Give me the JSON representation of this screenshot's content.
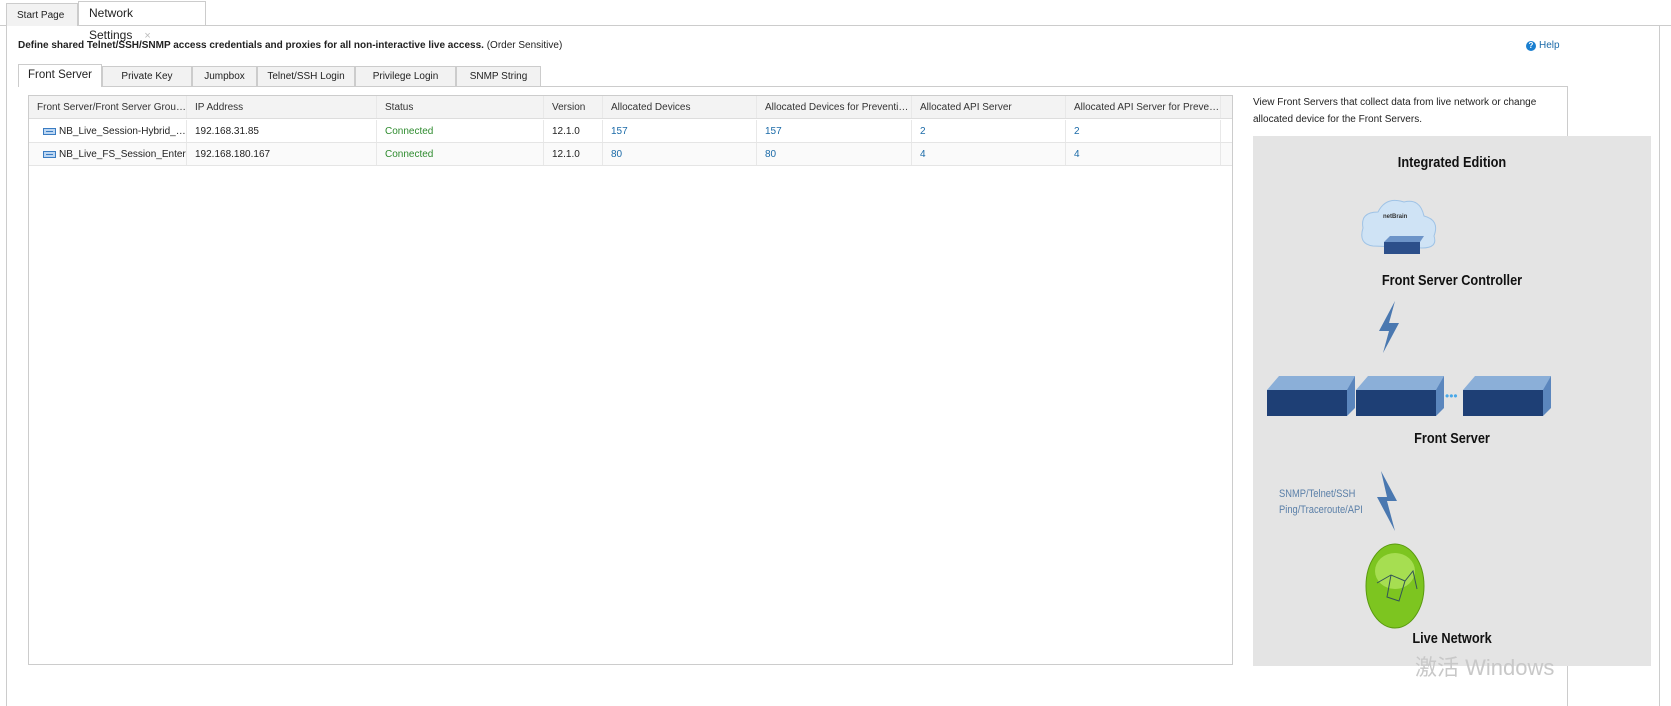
{
  "top_tabs": [
    {
      "label": "Start Page"
    },
    {
      "label": "Network Settings",
      "close": "×"
    }
  ],
  "description": {
    "bold": "Define shared Telnet/SSH/SNMP access credentials and proxies for all non-interactive live access.",
    "note": "(Order Sensitive)"
  },
  "help": {
    "icon": "?",
    "label": "Help"
  },
  "inner_tabs": [
    "Front Server",
    "Private Key",
    "Jumpbox",
    "Telnet/SSH Login",
    "Privilege Login",
    "SNMP String"
  ],
  "table": {
    "columns": [
      "Front Server/Front Server Group ...",
      "IP Address",
      "Status",
      "Version",
      "Allocated Devices",
      "Allocated Devices for Preventive ...",
      "Allocated API Server",
      "Allocated API Server for Preventiv..."
    ],
    "rows": [
      {
        "name": "NB_Live_Session-Hybrid_FS",
        "ip": "192.168.31.85",
        "status": "Connected",
        "version": "12.1.0",
        "alloc": "157",
        "alloc_prev": "157",
        "api": "2",
        "api_prev": "2"
      },
      {
        "name": "NB_Live_FS_Session_Enterprise",
        "ip": "192.168.180.167",
        "status": "Connected",
        "version": "12.1.0",
        "alloc": "80",
        "alloc_prev": "80",
        "api": "4",
        "api_prev": "4"
      }
    ]
  },
  "side": {
    "text": "View Front Servers that collect data from live network or change allocated device for the Front Servers.",
    "diagram": {
      "edition": "Integrated Edition",
      "controller": "Front Server Controller",
      "front_server": "Front Server",
      "protocols1": "SNMP/Telnet/SSH",
      "protocols2": "Ping/Traceroute/API",
      "live": "Live Network",
      "logo": "netBrain"
    }
  },
  "watermark": "激活 Windows",
  "colors": {
    "link": "#1a6aa8",
    "connected": "#2e8b2e"
  }
}
